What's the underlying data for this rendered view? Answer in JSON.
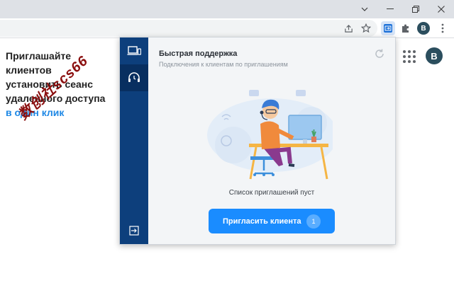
{
  "page": {
    "promo_line1": "Приглашайте клиентов",
    "promo_line2": "установить сеанс",
    "promo_line3": "удаленного доступа",
    "promo_highlight": "в один клик",
    "watermark": "数创社scs66",
    "avatar_letter": "B"
  },
  "toolbar": {
    "profile_letter": "B"
  },
  "popup": {
    "title": "Быстрая поддержка",
    "subtitle": "Подключения к клиентам по приглашениям",
    "empty_text": "Список приглашений пуст",
    "invite_label": "Пригласить клиента",
    "invite_count": "1"
  },
  "colors": {
    "rail": "#0d3f7c",
    "rail_active": "#082f60",
    "accent": "#1a8cff",
    "highlight": "#1e88e5",
    "watermark": "#8b0f0f"
  },
  "icons": {
    "rail": [
      "devices-icon",
      "support-headset-icon",
      "logout-icon"
    ],
    "toolbar": [
      "share-icon",
      "star-icon",
      "remote-access-extension-icon",
      "puzzle-extensions-icon",
      "more-vert-icon"
    ],
    "window": [
      "chevron-down-icon",
      "restore-icon",
      "close-icon"
    ]
  }
}
